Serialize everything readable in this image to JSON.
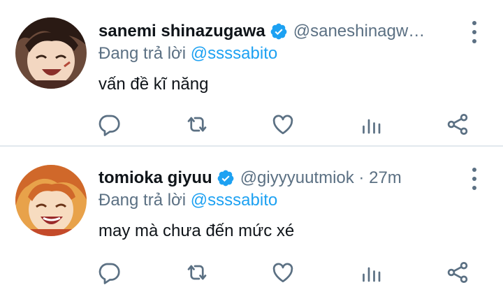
{
  "tweets": [
    {
      "display_name": "sanemi shinazugawa",
      "handle": "@saneshinagw…",
      "replying_prefix": "Đang trả lời ",
      "replying_mention": "@ssssabito",
      "text": "vấn đề kĩ năng",
      "verified": true
    },
    {
      "display_name": "tomioka giyuu",
      "handle": "@giyyyuutmiok · 27m",
      "replying_prefix": "Đang trả lời ",
      "replying_mention": "@ssssabito",
      "text": "may mà chưa đến mức xé",
      "verified": true
    }
  ],
  "icons": {
    "reply": "reply-icon",
    "retweet": "retweet-icon",
    "like": "heart-icon",
    "analytics": "analytics-icon",
    "share": "share-icon",
    "more": "more-vertical-icon",
    "verified": "verified-badge-icon"
  },
  "colors": {
    "accent": "#1da1f2",
    "secondary_text": "#5b7083",
    "divider": "#e1e8ed"
  }
}
